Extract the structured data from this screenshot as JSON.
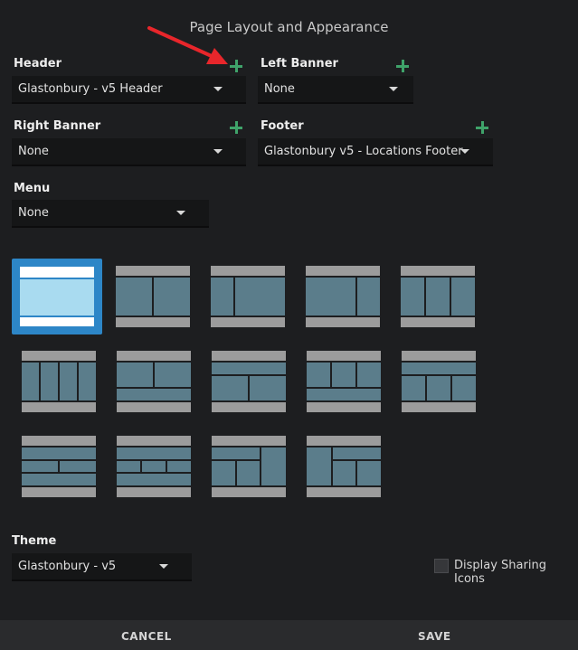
{
  "dialog": {
    "title": "Page Layout and Appearance"
  },
  "fields": {
    "header": {
      "label": "Header",
      "value": "Glastonbury - v5 Header"
    },
    "left_banner": {
      "label": "Left Banner",
      "value": "None"
    },
    "right_banner": {
      "label": "Right Banner",
      "value": "None"
    },
    "footer": {
      "label": "Footer",
      "value": "Glastonbury v5 - Locations Footer"
    },
    "menu": {
      "label": "Menu",
      "value": "None"
    },
    "theme": {
      "label": "Theme",
      "value": "Glastonbury - v5"
    }
  },
  "options": {
    "display_sharing_icons": "Display Sharing Icons"
  },
  "actions": {
    "cancel": "CANCEL",
    "save": "SAVE"
  },
  "colors": {
    "accent_plus": "#3fa36a",
    "selected_layout": "#2d86c7",
    "annotation_arrow": "#e8262b"
  }
}
